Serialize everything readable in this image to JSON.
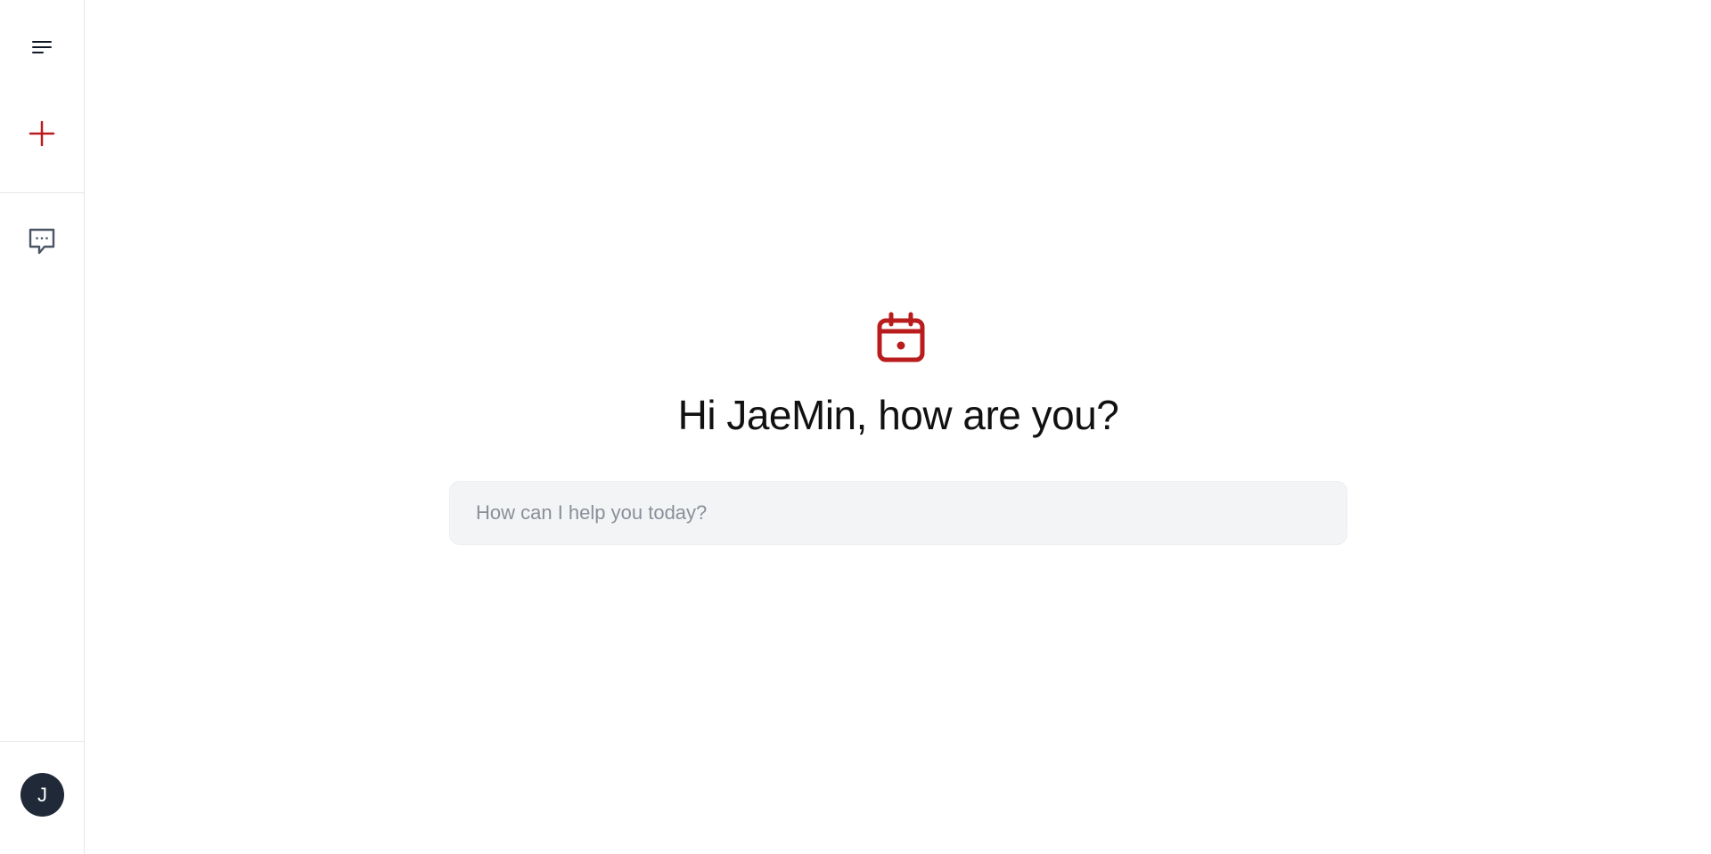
{
  "sidebar": {
    "menu_icon": "menu-icon",
    "new_chat_icon": "plus-icon",
    "chat_history_icon": "chat-bubble-icon",
    "avatar_initial": "J"
  },
  "main": {
    "hero_icon": "calendar-icon",
    "greeting": "Hi JaeMin, how are you?",
    "input": {
      "placeholder": "How can I help you today?",
      "value": ""
    }
  },
  "colors": {
    "accent": "#b91c1c",
    "avatar_bg": "#1f2937",
    "input_bg": "#f3f4f6"
  }
}
